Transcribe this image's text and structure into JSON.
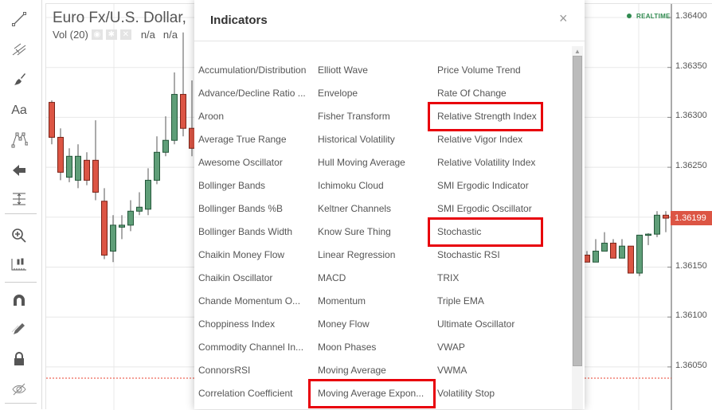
{
  "sidebar": {
    "tools": [
      {
        "name": "trend-line-icon"
      },
      {
        "name": "pitchfork-icon"
      },
      {
        "name": "brush-icon"
      },
      {
        "name": "text-icon",
        "label": "Aa"
      },
      {
        "name": "pattern-icon"
      },
      {
        "name": "arrow-left-icon"
      },
      {
        "name": "measure-icon"
      },
      {
        "name": "zoom-in-icon"
      },
      {
        "name": "ruler-icon"
      },
      {
        "name": "magnet-icon"
      },
      {
        "name": "pencil-icon"
      },
      {
        "name": "lock-icon"
      },
      {
        "name": "eye-off-icon"
      }
    ]
  },
  "chart": {
    "title": "Euro Fx/U.S. Dollar,",
    "vol_label": "Vol (20)",
    "vol_values": [
      "n/a",
      "n/a"
    ],
    "realtime": "REALTIME",
    "last_price": "1.36199",
    "colors": {
      "up": "#5f9e78",
      "down": "#dc5544",
      "last": "#dc5544"
    }
  },
  "chart_data": {
    "type": "candlestick",
    "y_ticks": [
      "1.36400",
      "1.36350",
      "1.36300",
      "1.36250",
      "1.36200",
      "1.36150",
      "1.36100",
      "1.36050"
    ],
    "ylim": [
      1.36021,
      1.36417
    ],
    "candles_left": [
      [
        1.36315,
        1.36317,
        1.36273,
        1.3628
      ],
      [
        1.3628,
        1.36289,
        1.36237,
        1.36245
      ],
      [
        1.3624,
        1.36269,
        1.36235,
        1.36261
      ],
      [
        1.36237,
        1.36273,
        1.36229,
        1.36261
      ],
      [
        1.36257,
        1.36265,
        1.36232,
        1.36237
      ],
      [
        1.36257,
        1.36297,
        1.36217,
        1.36225
      ],
      [
        1.36216,
        1.36229,
        1.36158,
        1.36162
      ],
      [
        1.36166,
        1.36202,
        1.36155,
        1.36192
      ],
      [
        1.3619,
        1.36202,
        1.36178,
        1.36192
      ],
      [
        1.36192,
        1.36217,
        1.36186,
        1.36206
      ],
      [
        1.36206,
        1.36225,
        1.36202,
        1.3621
      ],
      [
        1.36208,
        1.36249,
        1.36202,
        1.36237
      ],
      [
        1.36237,
        1.36281,
        1.36233,
        1.36265
      ],
      [
        1.36265,
        1.36301,
        1.36261,
        1.36277
      ],
      [
        1.36277,
        1.36345,
        1.36273,
        1.36323
      ],
      [
        1.36323,
        1.36385,
        1.36281,
        1.36289
      ],
      [
        1.36289,
        1.36337,
        1.36261,
        1.36269
      ]
    ],
    "candles_right": [
      [
        1.36162,
        1.36166,
        1.36155,
        1.36155
      ],
      [
        1.36155,
        1.36178,
        1.36155,
        1.36166
      ],
      [
        1.36166,
        1.36185,
        1.36166,
        1.36174
      ],
      [
        1.36174,
        1.36178,
        1.36159,
        1.36159
      ],
      [
        1.36159,
        1.36178,
        1.36159,
        1.36171
      ],
      [
        1.36171,
        1.36171,
        1.36144,
        1.36144
      ],
      [
        1.36144,
        1.36182,
        1.36141,
        1.36182
      ],
      [
        1.36182,
        1.36184,
        1.36172,
        1.36183
      ],
      [
        1.36183,
        1.36206,
        1.3618,
        1.36202
      ],
      [
        1.36202,
        1.36206,
        1.36185,
        1.36199
      ]
    ],
    "ohlc_order": [
      "open",
      "high",
      "low",
      "close"
    ]
  },
  "modal": {
    "title": "Indicators",
    "close": "×",
    "columns": [
      [
        "Accumulation/Distribution",
        "Advance/Decline Ratio ...",
        "Aroon",
        "Average True Range",
        "Awesome Oscillator",
        "Bollinger Bands",
        "Bollinger Bands %B",
        "Bollinger Bands Width",
        "Chaikin Money Flow",
        "Chaikin Oscillator",
        "Chande Momentum O...",
        "Choppiness Index",
        "Commodity Channel In...",
        "ConnorsRSI",
        "Correlation Coefficient"
      ],
      [
        "Elliott Wave",
        "Envelope",
        "Fisher Transform",
        "Historical Volatility",
        "Hull Moving Average",
        "Ichimoku Cloud",
        "Keltner Channels",
        "Know Sure Thing",
        "Linear Regression",
        "MACD",
        "Momentum",
        "Money Flow",
        "Moon Phases",
        "Moving Average",
        "Moving Average Expon..."
      ],
      [
        "Price Volume Trend",
        "Rate Of Change",
        "Relative Strength Index",
        "Relative Vigor Index",
        "Relative Volatility Index",
        "SMI Ergodic Indicator",
        "SMI Ergodic Oscillator",
        "Stochastic",
        "Stochastic RSI",
        "TRIX",
        "Triple EMA",
        "Ultimate Oscillator",
        "VWAP",
        "VWMA",
        "Volatility Stop"
      ]
    ],
    "highlighted": [
      "Relative Strength Index",
      "Stochastic",
      "Moving Average Expon..."
    ],
    "highlight_color": "#e8000b"
  }
}
